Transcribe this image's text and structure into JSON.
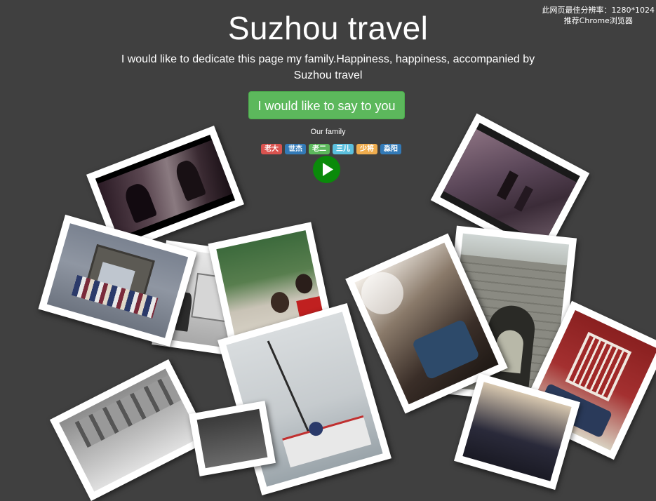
{
  "notice": {
    "line1": "此网页最佳分辨率：1280*1024",
    "line2": "推荐Chrome浏览器"
  },
  "header": {
    "title": "Suzhou travel",
    "subtitle": "I would like to dedicate this page my family.Happiness, happiness, accompanied by Suzhou travel"
  },
  "say_button": {
    "label": "I would like to say to you"
  },
  "family": {
    "label": "Our family",
    "members": [
      {
        "name": "老大",
        "color": "#d9534f"
      },
      {
        "name": "世杰",
        "color": "#337ab7"
      },
      {
        "name": "老二",
        "color": "#5cb85c"
      },
      {
        "name": "三儿",
        "color": "#5bc0de"
      },
      {
        "name": "少将",
        "color": "#f0ad4e"
      },
      {
        "name": "淼阳",
        "color": "#337ab7"
      }
    ]
  },
  "play_button": {
    "icon": "play-icon",
    "color": "#0a8a0a"
  },
  "photos": [
    {
      "id": "photo-dark-scene",
      "subject": "movie-scene"
    },
    {
      "id": "photo-night-street",
      "subject": "night-street"
    },
    {
      "id": "photo-group-gate",
      "subject": "group-at-gate"
    },
    {
      "id": "photo-museum",
      "subject": "indoor-exhibit"
    },
    {
      "id": "photo-bus-selfie",
      "subject": "bus-selfie"
    },
    {
      "id": "photo-boat",
      "subject": "sailboat"
    },
    {
      "id": "photo-bus-interior",
      "subject": "bus-interior"
    },
    {
      "id": "photo-city-gate",
      "subject": "ancient-city-gate"
    },
    {
      "id": "photo-red-window",
      "subject": "red-window"
    }
  ]
}
